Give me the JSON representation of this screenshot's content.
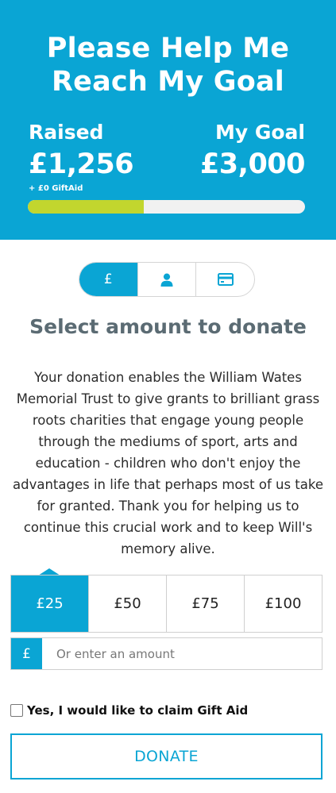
{
  "header": {
    "title_line1": "Please Help Me",
    "title_line2": "Reach My Goal",
    "raised_label": "Raised",
    "raised_value": "£1,256",
    "giftaid_note": "+ £0 GiftAid",
    "goal_label": "My Goal",
    "goal_value": "£3,000",
    "progress_fraction": 0.419,
    "colors": {
      "background": "#0aa5d4",
      "progress_fill": "#c2d62e",
      "progress_track": "#f1f1f1"
    }
  },
  "steps": {
    "items": [
      {
        "icon": "pound-icon",
        "glyph": "£",
        "active": true
      },
      {
        "icon": "user-icon",
        "active": false
      },
      {
        "icon": "credit-card-icon",
        "active": false
      }
    ]
  },
  "donation": {
    "heading": "Select amount to donate",
    "description": "Your donation enables the William Wates Memorial Trust to give grants to brilliant grass roots charities that engage young people through the mediums of sport, arts and education - children who don't enjoy the advantages in life that perhaps most of us take for granted. Thank you for helping us to continue this crucial work and to keep Will's memory alive.",
    "amounts": [
      {
        "label": "£25",
        "selected": true
      },
      {
        "label": "£50",
        "selected": false
      },
      {
        "label": "£75",
        "selected": false
      },
      {
        "label": "£100",
        "selected": false
      }
    ],
    "custom_currency": "£",
    "custom_placeholder": "Or enter an amount",
    "custom_value": "",
    "giftaid_label": "Yes, I would like to claim Gift Aid",
    "giftaid_checked": false,
    "donate_label": "DONATE"
  }
}
